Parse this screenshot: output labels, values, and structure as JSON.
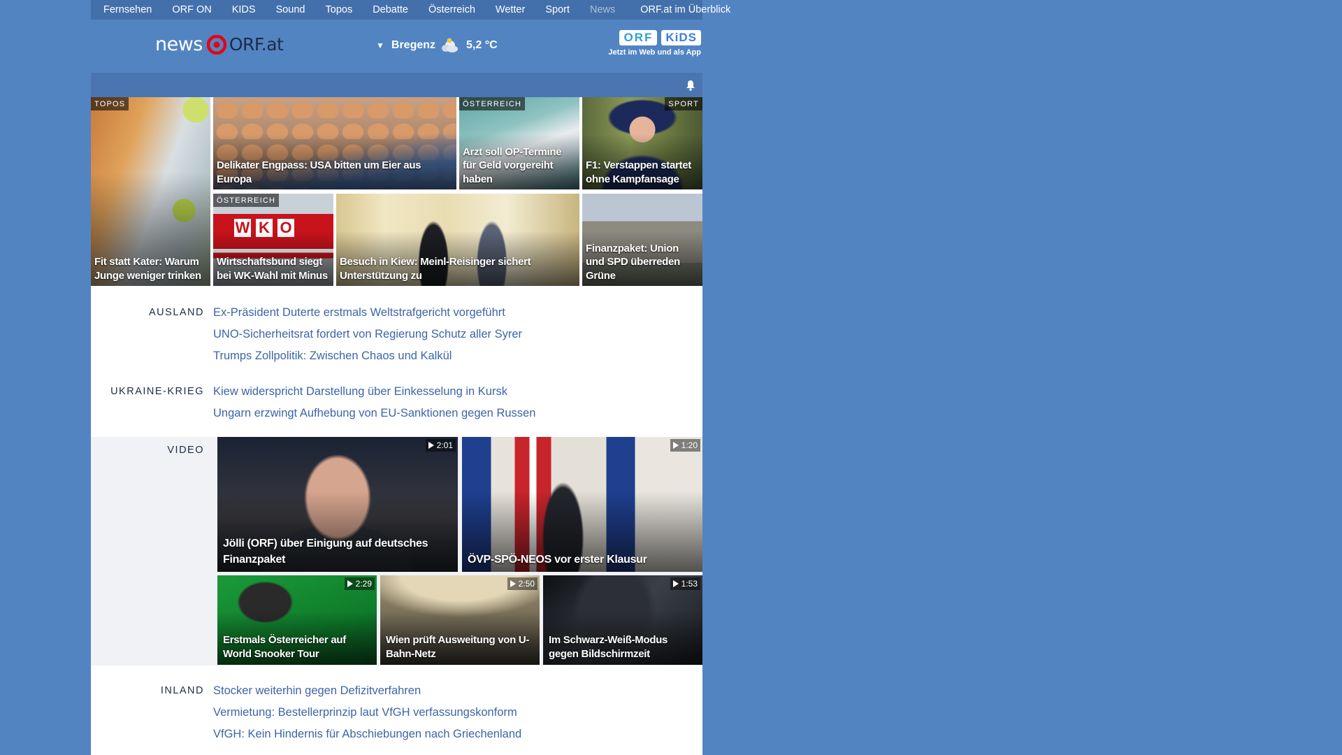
{
  "nav": {
    "items": [
      "Fernsehen",
      "ORF ON",
      "KIDS",
      "Sound",
      "Topos",
      "Debatte",
      "Österreich",
      "Wetter",
      "Sport",
      "News"
    ],
    "overview": "ORF.at im Überblick"
  },
  "header": {
    "logo_news": "news",
    "logo_orf": "ORF.at",
    "weather_city": "Bregenz",
    "weather_temp": "5,2 °C",
    "kids_badge_1": "ORF",
    "kids_badge_2": "KiDS",
    "kids_sub": "Jetzt im Web und als App"
  },
  "tiles": {
    "t1": {
      "tag": "TOPOS",
      "caption": "Fit statt Kater: Warum Junge weniger trinken"
    },
    "t2": {
      "caption": "Delikater Engpass: USA bitten um Eier aus Europa"
    },
    "t3": {
      "tag": "ÖSTERREICH",
      "caption": "Arzt soll OP-Termine für Geld vorgereiht haben"
    },
    "t4": {
      "tag": "SPORT",
      "caption": "F1: Verstappen startet ohne Kampfansage"
    },
    "t5": {
      "tag": "ÖSTERREICH",
      "caption": "Wirtschaftsbund siegt bei WK-Wahl mit Minus"
    },
    "t6": {
      "caption": "Besuch in Kiew: Meinl-Reisinger sichert Unterstützung zu"
    },
    "t7": {
      "caption": "Finanzpaket: Union und SPD überreden Grüne"
    }
  },
  "sections": {
    "ausland": {
      "label": "AUSLAND",
      "links": [
        "Ex-Präsident Duterte erstmals Weltstrafgericht vorgeführt",
        "UNO-Sicherheitsrat fordert von Regierung Schutz aller Syrer",
        "Trumps Zollpolitik: Zwischen Chaos und Kalkül"
      ]
    },
    "ukraine": {
      "label": "UKRAINE-KRIEG",
      "links": [
        "Kiew widerspricht Darstellung über Einkesselung in Kursk",
        "Ungarn erzwingt Aufhebung von EU-Sanktionen gegen Russen"
      ]
    },
    "inland": {
      "label": "INLAND",
      "links": [
        "Stocker weiterhin gegen Defizitverfahren",
        "Vermietung: Bestellerprinzip laut VfGH verfassungskonform",
        "VfGH: Kein Hindernis für Abschiebungen nach Griechenland"
      ]
    }
  },
  "video": {
    "label": "VIDEO",
    "items": [
      {
        "duration": "2:01",
        "caption": "Jölli (ORF) über Einigung auf deutsches Finanzpaket"
      },
      {
        "duration": "1:20",
        "caption": "ÖVP-SPÖ-NEOS vor erster Klausur"
      },
      {
        "duration": "2:29",
        "caption": "Erstmals Österreicher auf World Snooker Tour"
      },
      {
        "duration": "2:50",
        "caption": "Wien prüft Ausweitung von U-Bahn-Netz"
      },
      {
        "duration": "1:53",
        "caption": "Im Schwarz-Weiß-Modus gegen Bildschirmzeit"
      }
    ]
  },
  "icons": [
    "orf-eye-icon",
    "weather-cloud-icon",
    "bell-icon",
    "play-icon"
  ],
  "colors": {
    "background": "#5284c2",
    "nav_bar": "#4370ab",
    "link": "#3c65a8",
    "label": "#1c2b45",
    "logo_red": "#e30613"
  }
}
